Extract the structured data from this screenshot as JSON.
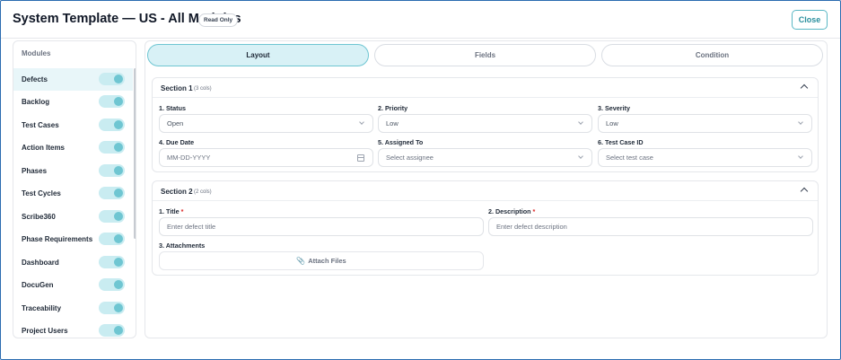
{
  "header": {
    "title": "System Template — US - All Modules",
    "badge": "Read Only",
    "close_label": "Close"
  },
  "sidebar": {
    "title": "Modules",
    "items": [
      {
        "label": "Defects",
        "enabled": true,
        "active": true
      },
      {
        "label": "Backlog",
        "enabled": true
      },
      {
        "label": "Test Cases",
        "enabled": true
      },
      {
        "label": "Action Items",
        "enabled": true
      },
      {
        "label": "Phases",
        "enabled": true
      },
      {
        "label": "Test Cycles",
        "enabled": true
      },
      {
        "label": "Scribe360",
        "enabled": true
      },
      {
        "label": "Phase Requirements",
        "enabled": true
      },
      {
        "label": "Dashboard",
        "enabled": true
      },
      {
        "label": "DocuGen",
        "enabled": true
      },
      {
        "label": "Traceability",
        "enabled": true
      },
      {
        "label": "Project Users",
        "enabled": true
      }
    ]
  },
  "tabs": [
    {
      "label": "Layout",
      "active": true
    },
    {
      "label": "Fields"
    },
    {
      "label": "Condition"
    }
  ],
  "section1": {
    "title": "Section 1",
    "cols": "(3 cols)",
    "fields": [
      {
        "label": "1. Status",
        "value": "Open"
      },
      {
        "label": "2. Priority",
        "value": "Low"
      },
      {
        "label": "3. Severity",
        "value": "Low"
      },
      {
        "label": "4. Due Date",
        "placeholder": "MM-DD-YYYY"
      },
      {
        "label": "5. Assigned To",
        "placeholder": "Select assignee"
      },
      {
        "label": "6. Test Case ID",
        "placeholder": "Select test case"
      }
    ]
  },
  "section2": {
    "title": "Section 2",
    "cols": "(2 cols)",
    "fields": [
      {
        "label": "1. Title",
        "required": "*",
        "placeholder": "Enter defect title"
      },
      {
        "label": "2. Description",
        "required": "*",
        "placeholder": "Enter defect description"
      },
      {
        "label": "3. Attachments",
        "button": "Attach Files"
      }
    ]
  },
  "colors": {
    "accent": "#6fc6d2",
    "active_bg": "#e8f6f9",
    "required": "#dc2626"
  }
}
